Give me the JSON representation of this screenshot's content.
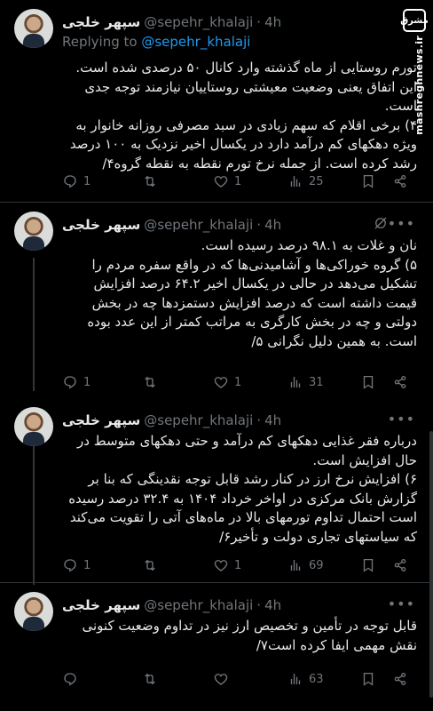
{
  "watermark": {
    "logo": "مشرق",
    "site": "mashreghnews.ir"
  },
  "tweets": [
    {
      "name": "سپهر خلجی",
      "handle": "@sepehr_khalaji",
      "dot": "·",
      "time": "4h",
      "replying_prefix": "Replying to",
      "replying_to": "@sepehr_khalaji",
      "text": "تورم روستایی از ماه گذشته وارد کانال ۵۰ درصدی شده است. این اتفاق یعنی وضعیت معیشتی روستاییان نیازمند توجه جدی است.\n۴) برخی اقلام که سهم زیادی در سبد مصرفی روزانه خانوار به ویژه دهکهای کم درآمد دارد در یکسال اخیر نزدیک به ۱۰۰ درصد رشد کرده است. از جمله نرخ تورم نقطه به نقطه گروه۴/",
      "replies": "1",
      "retweets": "",
      "likes": "1",
      "views": "25"
    },
    {
      "name": "سپهر خلجی",
      "handle": "@sepehr_khalaji",
      "dot": "·",
      "time": "4h",
      "text": "نان و غلات به ۹۸.۱ درصد رسیده است.\n۵) گروه خوراکی‌ها و آشامیدنی‌ها که در واقع سفره مردم را تشکیل می‌دهد در حالی در یکسال اخیر ۶۴.۲ درصد افزایش قیمت داشته است که درصد افزایش دستمزدها چه در بخش دولتی و چه در بخش کارگری به مراتب کمتر از این عدد بوده است. به همین دلیل نگرانی ۵/",
      "replies": "1",
      "retweets": "",
      "likes": "1",
      "views": "31"
    },
    {
      "name": "سپهر خلجی",
      "handle": "@sepehr_khalaji",
      "dot": "·",
      "time": "4h",
      "text": "درباره فقر غذایی دهکهای کم درآمد و حتی دهکهای متوسط در حال افزایش است.\n۶) افزایش نرخ ارز در کنار رشد قابل توجه نقدینگی که بنا بر گزارش بانک مرکزی در اواخر خرداد ۱۴۰۴ به ۳۲.۴ درصد رسیده است احتمال تداوم تورمهای بالا در ماه‌های آتی را تقویت می‌کند که سیاستهای تجاری دولت و تأخیر۶/",
      "replies": "1",
      "retweets": "",
      "likes": "1",
      "views": "69"
    },
    {
      "name": "سپهر خلجی",
      "handle": "@sepehr_khalaji",
      "dot": "·",
      "time": "4h",
      "text": "قابل توجه در تأمین و تخصیص ارز نیز در تداوم وضعیت کنونی نقش مهمی ایفا کرده است۷/",
      "replies": "",
      "retweets": "",
      "likes": "",
      "views": "63"
    }
  ]
}
